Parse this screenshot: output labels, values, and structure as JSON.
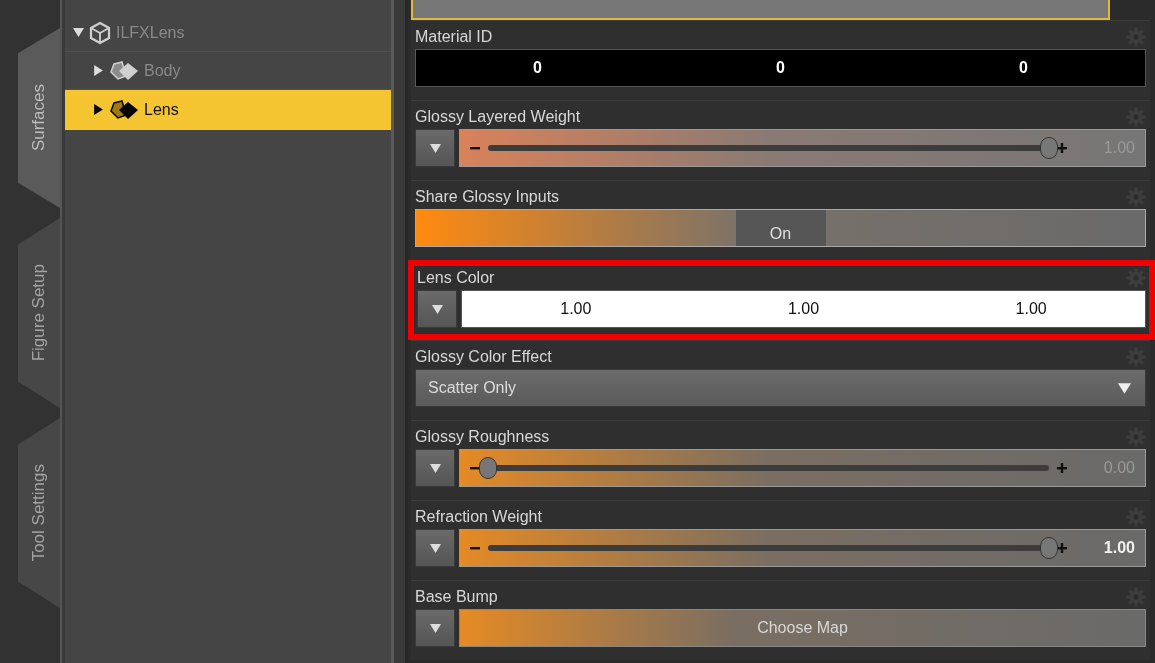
{
  "side_tabs": [
    {
      "label": "Surfaces",
      "selected": true
    },
    {
      "label": "Figure Setup",
      "selected": false
    },
    {
      "label": "Tool Settings",
      "selected": false
    }
  ],
  "tree": {
    "items": [
      {
        "label": "ILFXLens",
        "kind": "figure",
        "expanded": true,
        "selected": false,
        "children": [
          {
            "label": "Body",
            "kind": "surface",
            "expanded": false,
            "selected": false
          },
          {
            "label": "Lens",
            "kind": "surface",
            "expanded": false,
            "selected": true
          }
        ]
      }
    ]
  },
  "properties": [
    {
      "label": "Material ID",
      "kind": "numbers",
      "values": [
        "0",
        "0",
        "0"
      ],
      "highlighted": false
    },
    {
      "label": "Glossy Layered Weight",
      "kind": "slider",
      "level": 1,
      "value": "1.00",
      "emphasized": false,
      "highlighted": false
    },
    {
      "label": "Share Glossy Inputs",
      "kind": "toggle",
      "on": true,
      "value": "On",
      "highlighted": false
    },
    {
      "label": "Lens Color",
      "kind": "color",
      "values": [
        "1.00",
        "1.00",
        "1.00"
      ],
      "highlighted": true
    },
    {
      "label": "Glossy Color Effect",
      "kind": "dropdown",
      "value": "Scatter Only",
      "highlighted": false
    },
    {
      "label": "Glossy Roughness",
      "kind": "slider",
      "level": 0,
      "value": "0.00",
      "emphasized": false,
      "highlighted": false
    },
    {
      "label": "Refraction Weight",
      "kind": "slider",
      "level": 1,
      "value": "1.00",
      "emphasized": true,
      "highlighted": false
    },
    {
      "label": "Base Bump",
      "kind": "map",
      "value": "Choose Map",
      "highlighted": false
    }
  ]
}
